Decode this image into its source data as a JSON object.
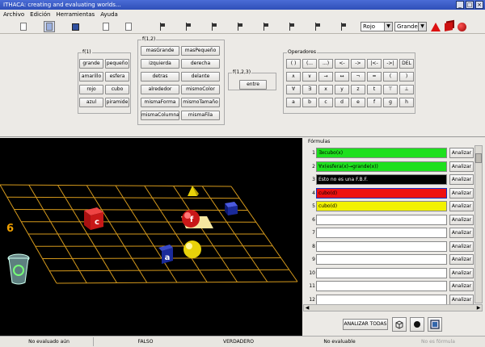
{
  "window": {
    "title": "ITHACA: creating and evaluating worlds..."
  },
  "menu": [
    "Archivo",
    "Edición",
    "Herramientas",
    "Ayuda"
  ],
  "toolbar": {
    "color_select": "Rojo",
    "size_select": "Grande",
    "shapes": [
      "tetrahedron-icon",
      "cube-icon",
      "sphere-icon"
    ],
    "shape_color": "#d11111"
  },
  "groups": {
    "f1": {
      "title": "f(1)",
      "buttons": [
        "grande",
        "pequeño",
        "amarillo",
        "esfera",
        "rojo",
        "cubo",
        "azul",
        "piramide"
      ]
    },
    "f12": {
      "title": "f(1,2)",
      "buttons": [
        "masGrande",
        "masPequeño",
        "izquierda",
        "derecha",
        "detras",
        "delante",
        "alrededor",
        "mismoColor",
        "mismaForma",
        "mismoTamaño",
        "mismaColumna",
        "mismaFila"
      ]
    },
    "f123": {
      "title": "f(1,2,3)",
      "buttons": [
        "entre"
      ]
    },
    "operators": {
      "title": "Operadores",
      "buttons": [
        "( )",
        "(...",
        "...)",
        "<-",
        "->",
        "|<-",
        "->|",
        "DEL",
        "∧",
        "∨",
        "→",
        "↔",
        "¬",
        "=",
        "(",
        ")",
        "∀",
        "∃",
        "x",
        "y",
        "z",
        "t",
        "⊤",
        "⊥",
        "a",
        "b",
        "c",
        "d",
        "e",
        "f",
        "g",
        "h"
      ]
    }
  },
  "world": {
    "counter": "6",
    "objects": [
      {
        "label": "c",
        "shape": "cube",
        "color": "#c81818"
      },
      {
        "label": "f",
        "shape": "sphere",
        "color": "#c81818"
      },
      {
        "label": "a",
        "shape": "cube",
        "color": "#1a2a9a"
      },
      {
        "label": "",
        "shape": "sphere",
        "color": "#e8d20a"
      },
      {
        "label": "",
        "shape": "tetrahedron",
        "color": "#e8d20a"
      },
      {
        "label": "",
        "shape": "cube",
        "color": "#1a2a9a"
      }
    ],
    "grid_color": "#d69a1c"
  },
  "formulas": {
    "title": "Fórmulas",
    "button_label": "Analizar",
    "rows": [
      {
        "n": "1",
        "text": "∃xcubo(x)",
        "bg": "#1ee01e",
        "fg": "#000000"
      },
      {
        "n": "2",
        "text": "∀x(esfera(x)→grande(x))",
        "bg": "#1ee01e",
        "fg": "#000000"
      },
      {
        "n": "3",
        "text": "Esto no es una F.B.F.",
        "bg": "#000000",
        "fg": "#ffffff"
      },
      {
        "n": "4",
        "text": "cubo(d)",
        "bg": "#ee1111",
        "fg": "#000000"
      },
      {
        "n": "5",
        "text": "cubo(d)",
        "bg": "#f2f200",
        "fg": "#000000"
      },
      {
        "n": "6",
        "text": "",
        "bg": "#ffffff",
        "fg": "#000000"
      },
      {
        "n": "7",
        "text": "",
        "bg": "#ffffff",
        "fg": "#000000"
      },
      {
        "n": "8",
        "text": "",
        "bg": "#ffffff",
        "fg": "#000000"
      },
      {
        "n": "9",
        "text": "",
        "bg": "#ffffff",
        "fg": "#000000"
      },
      {
        "n": "10",
        "text": "",
        "bg": "#ffffff",
        "fg": "#000000"
      },
      {
        "n": "11",
        "text": "",
        "bg": "#ffffff",
        "fg": "#000000"
      },
      {
        "n": "12",
        "text": "",
        "bg": "#ffffff",
        "fg": "#000000"
      }
    ],
    "analyze_all": "ANALIZAR TODAS"
  },
  "status": {
    "not_evaluated": "No evaluado aún",
    "false": "FALSO",
    "true": "VERDADERO",
    "not_evaluable": "No evaluable",
    "wrong": "No es fórmula"
  }
}
